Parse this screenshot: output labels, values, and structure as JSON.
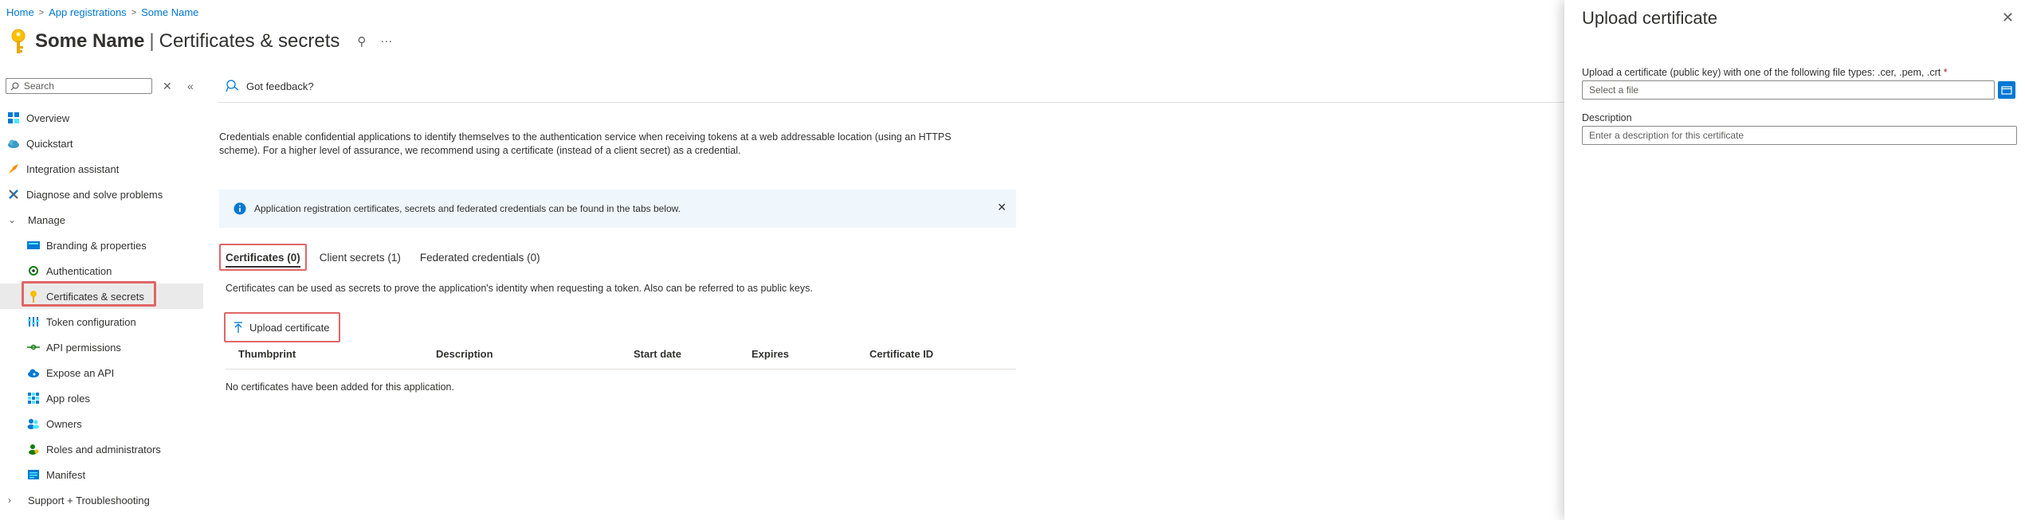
{
  "breadcrumb": [
    "Home",
    "App registrations",
    "Some Name"
  ],
  "header": {
    "app_name": "Some Name",
    "section": "Certificates & secrets",
    "pin": "⚲",
    "more": "···"
  },
  "sidebar": {
    "search_placeholder": "Search",
    "items": [
      {
        "label": "Overview",
        "icon": "grid-icon"
      },
      {
        "label": "Quickstart",
        "icon": "cloud-icon"
      },
      {
        "label": "Integration assistant",
        "icon": "rocket-icon"
      },
      {
        "label": "Diagnose and solve problems",
        "icon": "wrench-icon"
      },
      {
        "label": "Manage",
        "icon": "chevron-down-icon"
      },
      {
        "label": "Branding & properties",
        "icon": "card-icon"
      },
      {
        "label": "Authentication",
        "icon": "refresh-icon"
      },
      {
        "label": "Certificates & secrets",
        "icon": "key-icon"
      },
      {
        "label": "Token configuration",
        "icon": "bars-icon"
      },
      {
        "label": "API permissions",
        "icon": "arrows-icon"
      },
      {
        "label": "Expose an API",
        "icon": "cloud-api-icon"
      },
      {
        "label": "App roles",
        "icon": "grid-roles-icon"
      },
      {
        "label": "Owners",
        "icon": "people-icon"
      },
      {
        "label": "Roles and administrators",
        "icon": "person-icon"
      },
      {
        "label": "Manifest",
        "icon": "manifest-icon"
      },
      {
        "label": "Support + Troubleshooting",
        "icon": "chevron-right-icon"
      }
    ]
  },
  "main": {
    "feedback": "Got feedback?",
    "intro": "Credentials enable confidential applications to identify themselves to the authentication service when receiving tokens at a web addressable location (using an HTTPS scheme). For a higher level of assurance, we recommend using a certificate (instead of a client secret) as a credential.",
    "info": "Application registration certificates, secrets and federated credentials can be found in the tabs below.",
    "tabs": [
      "Certificates (0)",
      "Client secrets (1)",
      "Federated credentials (0)"
    ],
    "tab_description": "Certificates can be used as secrets to prove the application's identity when requesting a token. Also can be referred to as public keys.",
    "upload_button": "Upload certificate",
    "columns": [
      "Thumbprint",
      "Description",
      "Start date",
      "Expires",
      "Certificate ID"
    ],
    "empty_message": "No certificates have been added for this application."
  },
  "panel": {
    "title": "Upload certificate",
    "file_label": "Upload a certificate (public key) with one of the following file types: .cer, .pem, .crt",
    "required_mark": "*",
    "file_placeholder": "Select a file",
    "description_label": "Description",
    "description_placeholder": "Enter a description for this certificate"
  },
  "colors": {
    "accent": "#0078d4",
    "highlight": "#e06666",
    "info_bg": "#eff6fc"
  }
}
